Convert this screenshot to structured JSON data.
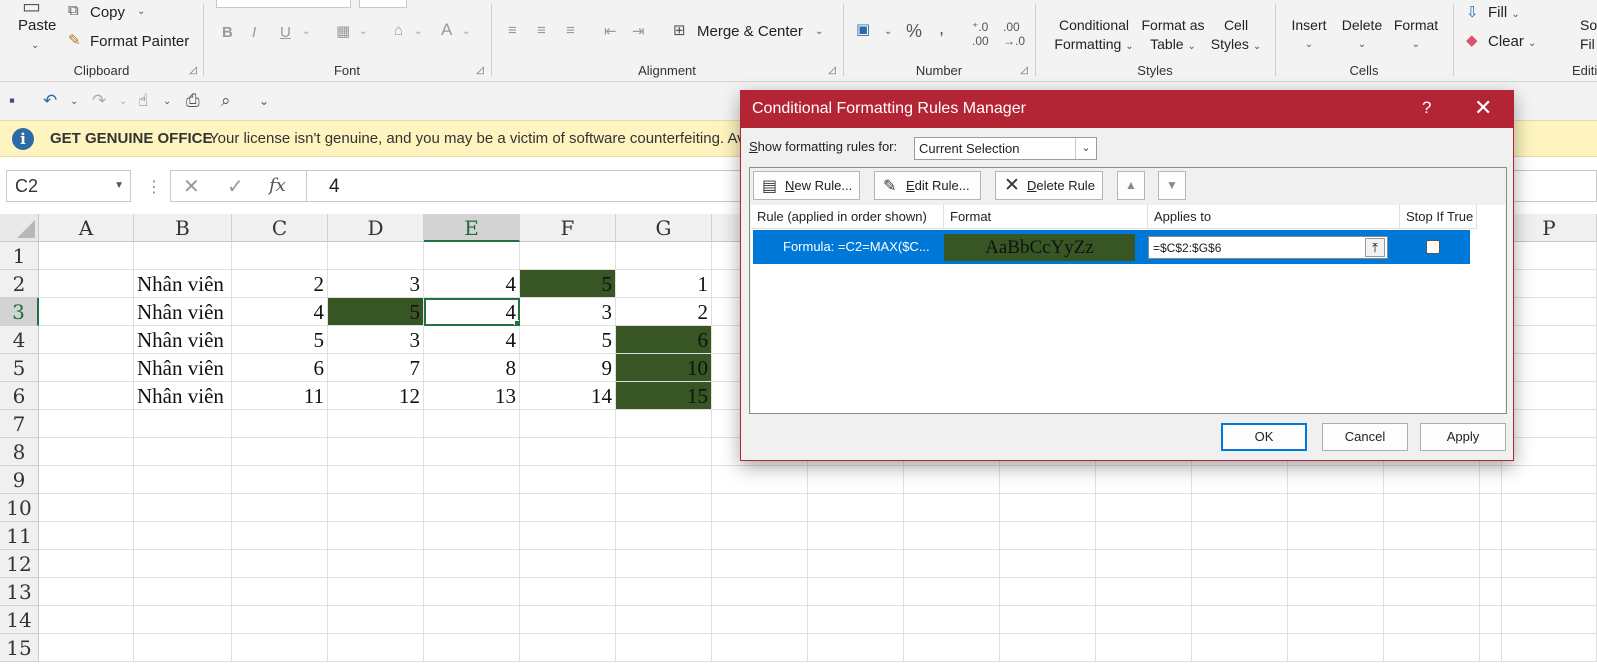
{
  "ribbon": {
    "clipboard": {
      "label": "Clipboard",
      "paste": "Paste",
      "copy": "Copy",
      "format_painter": "Format Painter"
    },
    "font": {
      "label": "Font"
    },
    "alignment": {
      "label": "Alignment",
      "merge_center": "Merge & Center"
    },
    "number": {
      "label": "Number"
    },
    "styles": {
      "label": "Styles",
      "conditional_l1": "Conditional",
      "conditional_l2": "Formatting",
      "format_table_l1": "Format as",
      "format_table_l2": "Table",
      "cell_styles_l1": "Cell",
      "cell_styles_l2": "Styles"
    },
    "cells": {
      "label": "Cells",
      "insert": "Insert",
      "delete": "Delete",
      "format": "Format"
    },
    "editing": {
      "label": "Editing",
      "fill": "Fill",
      "clear": "Clear",
      "sort_l1": "So",
      "sort_l2": "Fil"
    }
  },
  "banner": {
    "title": "GET GENUINE OFFICE",
    "message": "Your license isn't genuine, and you may be a victim of software counterfeiting. Av"
  },
  "formula_bar": {
    "name_box": "C2",
    "formula": "4"
  },
  "sheet": {
    "columns": [
      "A",
      "B",
      "C",
      "D",
      "E",
      "F",
      "G",
      "P"
    ],
    "rows": [
      "1",
      "2",
      "3",
      "4",
      "5",
      "6",
      "7",
      "8",
      "9",
      "10",
      "11",
      "12",
      "13",
      "14",
      "15"
    ],
    "data": [
      [
        "Nhân viên",
        "2",
        "3",
        "4",
        "5",
        "1"
      ],
      [
        "Nhân viên",
        "4",
        "5",
        "4",
        "3",
        "2"
      ],
      [
        "Nhân viên",
        "5",
        "3",
        "4",
        "5",
        "6"
      ],
      [
        "Nhân viên",
        "6",
        "7",
        "8",
        "9",
        "10"
      ],
      [
        "Nhân viên",
        "11",
        "12",
        "13",
        "14",
        "15"
      ]
    ],
    "highlight_color": "#375623"
  },
  "dialog": {
    "title": "Conditional Formatting Rules Manager",
    "help": "?",
    "close": "✕",
    "show_label_pre": "",
    "show_label_accel": "S",
    "show_label_post": "how formatting rules for:",
    "show_value": "Current Selection",
    "new_rule_accel": "N",
    "new_rule_rest": "ew Rule...",
    "edit_rule_accel": "E",
    "edit_rule_rest": "dit Rule...",
    "delete_rule_accel": "D",
    "delete_rule_rest": "elete Rule",
    "headers": {
      "rule": "Rule (applied in order shown)",
      "format": "Format",
      "applies": "Applies to",
      "stop": "Stop If True"
    },
    "rule": {
      "text": "Formula: =C2=MAX($C...",
      "preview": "AaBbCcYyZz",
      "applies_to": "=$C$2:$G$6"
    },
    "ok": "OK",
    "cancel": "Cancel",
    "apply": "Apply",
    "accent": "#b32435",
    "selection": "#0078d7"
  }
}
